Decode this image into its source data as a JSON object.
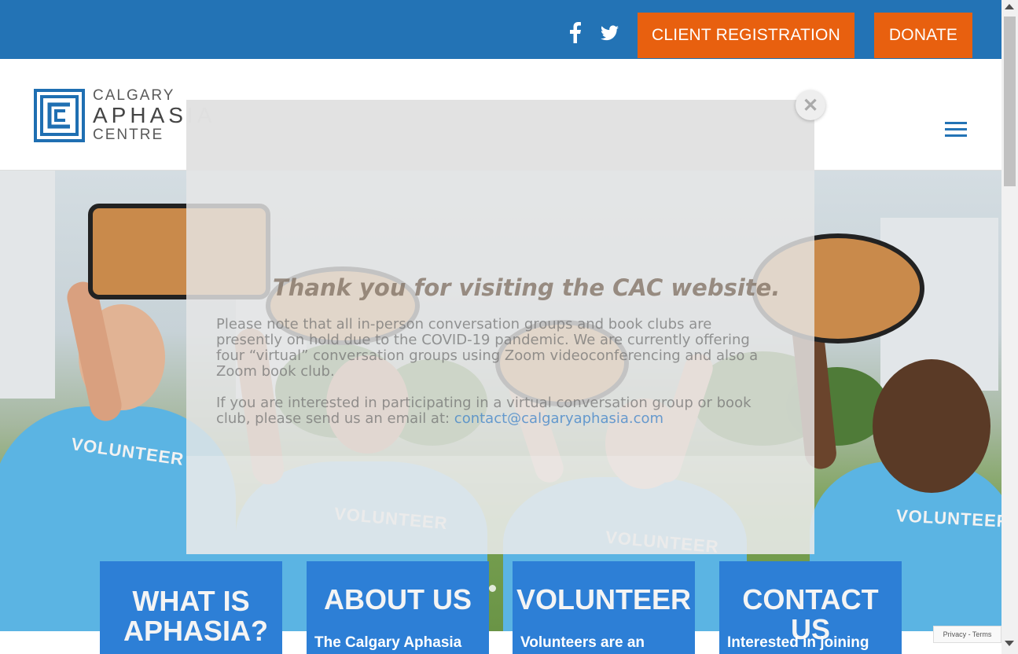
{
  "topbar": {
    "facebook_icon": "facebook-icon",
    "twitter_icon": "twitter-icon",
    "client_registration_label": "CLIENT REGISTRATION",
    "donate_label": "DONATE",
    "accent_color": "#e8600f",
    "bar_color": "#2373b5"
  },
  "header": {
    "logo_line1": "CALGARY",
    "logo_line2": "APHASIA",
    "logo_line3": "CENTRE",
    "menu_icon": "hamburger-menu-icon"
  },
  "popup": {
    "title": "Thank you for visiting the CAC website.",
    "paragraph1": "Please note that all in-person conversation groups and book clubs are presently on hold due to the COVID-19 pandemic. We are currently offering four “virtual” conversation groups using Zoom videoconferencing and also a Zoom book club.",
    "paragraph2_prefix": "If you are interested in participating in a virtual conversation group or book club, please send us an email at: ",
    "email": "contact@calgaryaphasia.com",
    "close_icon": "close-icon"
  },
  "hero": {
    "shirt_text": "VOLUNTEER"
  },
  "cards": [
    {
      "title": "WHAT IS APHASIA?",
      "text": ""
    },
    {
      "title": "ABOUT US",
      "text": "The Calgary Aphasia"
    },
    {
      "title": "VOLUNTEER",
      "text": "Volunteers are an"
    },
    {
      "title": "CONTACT US",
      "text": "Interested in joining"
    }
  ],
  "recaptcha": {
    "text": "Privacy - Terms"
  }
}
